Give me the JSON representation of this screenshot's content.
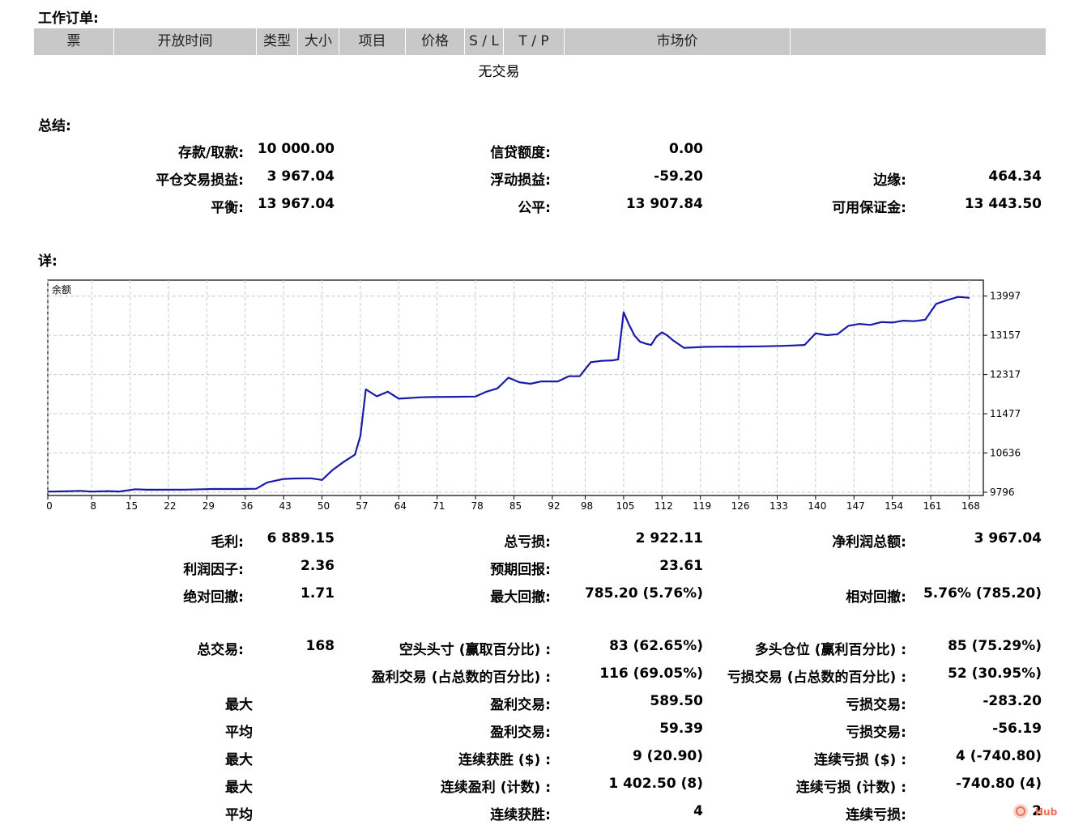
{
  "orders": {
    "title": "工作订单:",
    "columns": [
      "票",
      "开放时间",
      "类型",
      "大小",
      "项目",
      "价格",
      "S / L",
      "T / P",
      "市场价",
      ""
    ],
    "empty_text": "无交易"
  },
  "summary": {
    "title": "总结:",
    "rows": [
      [
        {
          "label": "存款/取款:",
          "value": "10 000.00"
        },
        {
          "label": "信贷额度:",
          "value": "0.00"
        },
        {
          "label": "",
          "value": ""
        }
      ],
      [
        {
          "label": "平仓交易损益:",
          "value": "3 967.04"
        },
        {
          "label": "浮动损益:",
          "value": "-59.20"
        },
        {
          "label": "边缘:",
          "value": "464.34"
        }
      ],
      [
        {
          "label": "平衡:",
          "value": "13 967.04"
        },
        {
          "label": "公平:",
          "value": "13 907.84"
        },
        {
          "label": "可用保证金:",
          "value": "13 443.50"
        }
      ]
    ]
  },
  "details": {
    "title": "详:"
  },
  "chart_data": {
    "type": "line",
    "legend": "余额",
    "x_ticks": [
      "0",
      "8",
      "15",
      "22",
      "29",
      "36",
      "43",
      "50",
      "57",
      "64",
      "71",
      "78",
      "85",
      "92",
      "98",
      "105",
      "112",
      "119",
      "126",
      "133",
      "140",
      "147",
      "154",
      "161",
      "168"
    ],
    "y_ticks": [
      "13997",
      "13157",
      "12317",
      "11477",
      "10636",
      "9796"
    ],
    "ylim": [
      9796,
      14400
    ],
    "xlim": [
      0,
      170
    ],
    "series": [
      {
        "name": "余额",
        "color": "#1a1aa8",
        "x": [
          0,
          3,
          6,
          8,
          11,
          13,
          16,
          18,
          20,
          25,
          30,
          35,
          38,
          40,
          43,
          45,
          48,
          50,
          52,
          54,
          56,
          57,
          58,
          60,
          62,
          64,
          66,
          68,
          70,
          74,
          78,
          80,
          82,
          84,
          86,
          88,
          90,
          93,
          95,
          97,
          99,
          101,
          103,
          104,
          105,
          106,
          107,
          108,
          109,
          110,
          111,
          112,
          113,
          114,
          116,
          118,
          120,
          124,
          126,
          130,
          134,
          136,
          138,
          140,
          142,
          144,
          146,
          148,
          150,
          152,
          154,
          156,
          158,
          160,
          162,
          164,
          166,
          168
        ],
        "y": [
          9810,
          9815,
          9825,
          9810,
          9820,
          9812,
          9860,
          9850,
          9850,
          9852,
          9865,
          9865,
          9870,
          10005,
          10080,
          10090,
          10095,
          10060,
          10280,
          10450,
          10600,
          11000,
          12000,
          11850,
          11950,
          11800,
          11815,
          11830,
          11835,
          11840,
          11845,
          11950,
          12020,
          12250,
          12150,
          12120,
          12170,
          12170,
          12280,
          12280,
          12580,
          12610,
          12620,
          12640,
          13650,
          13380,
          13150,
          13020,
          12980,
          12950,
          13130,
          13220,
          13150,
          13050,
          12890,
          12900,
          12910,
          12915,
          12915,
          12920,
          12930,
          12940,
          12950,
          13200,
          13160,
          13180,
          13360,
          13400,
          13380,
          13440,
          13430,
          13470,
          13460,
          13490,
          13830,
          13910,
          13980,
          13960
        ]
      }
    ],
    "grid": true
  },
  "stats": {
    "block1": [
      [
        {
          "label": "毛利:",
          "value": "6 889.15"
        },
        {
          "label": "总亏损:",
          "value": "2 922.11"
        },
        {
          "label": "净利润总额:",
          "value": "3 967.04"
        }
      ],
      [
        {
          "label": "利润因子:",
          "value": "2.36"
        },
        {
          "label": "预期回报:",
          "value": "23.61"
        },
        {
          "label": "",
          "value": ""
        }
      ],
      [
        {
          "label": "绝对回撤:",
          "value": "1.71"
        },
        {
          "label": "最大回撤:",
          "value": "785.20 (5.76%)"
        },
        {
          "label": "相对回撤:",
          "value": "5.76% (785.20)"
        }
      ]
    ],
    "block2": [
      [
        {
          "label": "总交易:",
          "value": "168"
        },
        {
          "label": "空头头寸 (赢取百分比) :",
          "value": "83 (62.65%)"
        },
        {
          "label": "多头仓位 (赢利百分比) :",
          "value": "85 (75.29%)"
        }
      ],
      [
        {
          "label": "",
          "value": ""
        },
        {
          "label": "盈利交易 (占总数的百分比) :",
          "value": "116 (69.05%)"
        },
        {
          "label": "亏损交易 (占总数的百分比) :",
          "value": "52 (30.95%)"
        }
      ],
      [
        {
          "label": "最大",
          "value": ""
        },
        {
          "label": "盈利交易:",
          "value": "589.50"
        },
        {
          "label": "亏损交易:",
          "value": "-283.20"
        }
      ],
      [
        {
          "label": "平均",
          "value": ""
        },
        {
          "label": "盈利交易:",
          "value": "59.39"
        },
        {
          "label": "亏损交易:",
          "value": "-56.19"
        }
      ],
      [
        {
          "label": "最大",
          "value": ""
        },
        {
          "label": "连续获胜 ($) :",
          "value": "9 (20.90)"
        },
        {
          "label": "连续亏损 ($) :",
          "value": "4 (-740.80)"
        }
      ],
      [
        {
          "label": "最大",
          "value": ""
        },
        {
          "label": "连续盈利 (计数) :",
          "value": "1 402.50 (8)"
        },
        {
          "label": "连续亏损 (计数) :",
          "value": "-740.80 (4)"
        }
      ],
      [
        {
          "label": "平均",
          "value": ""
        },
        {
          "label": "连续获胜:",
          "value": "4"
        },
        {
          "label": "连续亏损:",
          "value": "2"
        }
      ]
    ]
  },
  "watermark": {
    "text": "Hub",
    "color": "#f07050"
  }
}
